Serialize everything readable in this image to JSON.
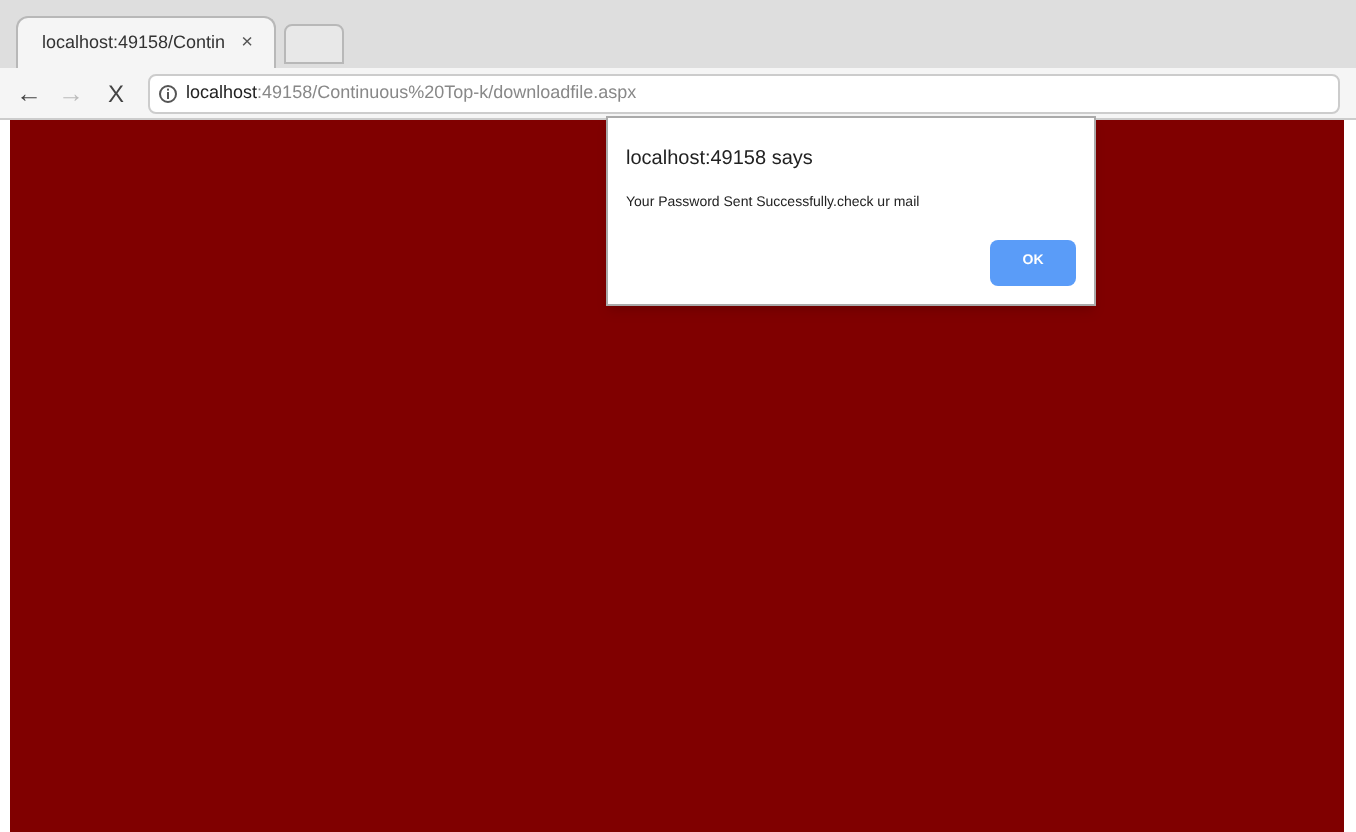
{
  "tabs": [
    {
      "title": "localhost:49158/Contin",
      "close": "×",
      "selected": true
    }
  ],
  "toolbar": {
    "back": "←",
    "forward": "→",
    "stop": "X"
  },
  "address_bar": {
    "host": "localhost",
    "path": ":49158/Continuous%20Top-k/downloadfile.aspx"
  },
  "dialog": {
    "title": "localhost:49158 says",
    "message": "Your Password Sent Successfully.check ur mail",
    "button": "OK"
  }
}
